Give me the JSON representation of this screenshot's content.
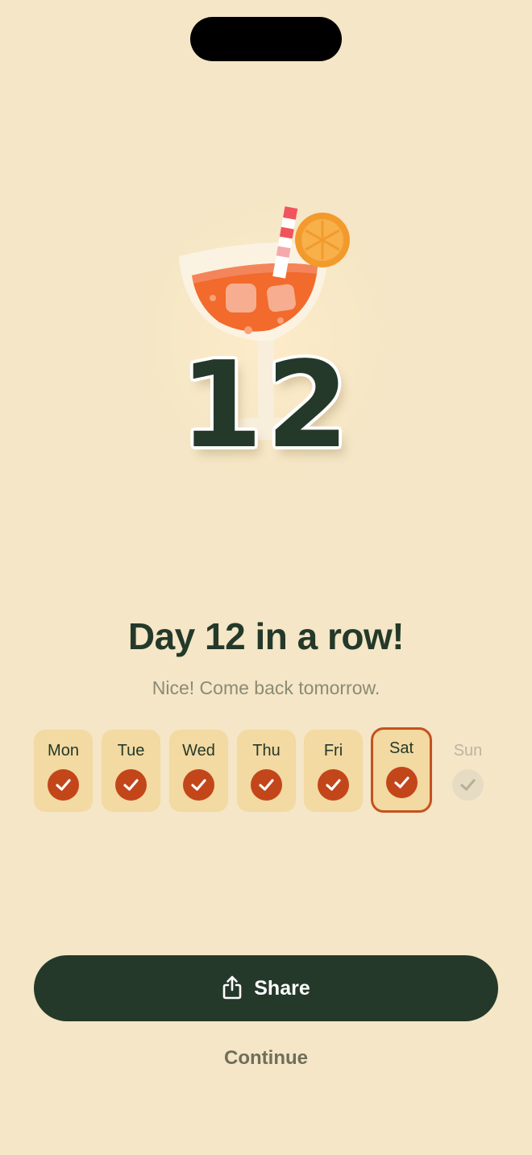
{
  "streak": {
    "count": "12",
    "headline": "Day 12 in a row!",
    "subtitle": "Nice! Come back tomorrow.",
    "illustration_icon": "cocktail-glass-icon"
  },
  "week": {
    "days": [
      {
        "label": "Mon",
        "completed": true,
        "current": false
      },
      {
        "label": "Tue",
        "completed": true,
        "current": false
      },
      {
        "label": "Wed",
        "completed": true,
        "current": false
      },
      {
        "label": "Thu",
        "completed": true,
        "current": false
      },
      {
        "label": "Fri",
        "completed": true,
        "current": false
      },
      {
        "label": "Sat",
        "completed": true,
        "current": true
      },
      {
        "label": "Sun",
        "completed": false,
        "current": false
      }
    ]
  },
  "actions": {
    "share_label": "Share",
    "share_icon": "share-icon",
    "continue_label": "Continue"
  },
  "colors": {
    "background": "#F4E6C6",
    "primary_dark": "#24392A",
    "accent": "#C2461A",
    "day_tile": "#F3D9A2"
  }
}
